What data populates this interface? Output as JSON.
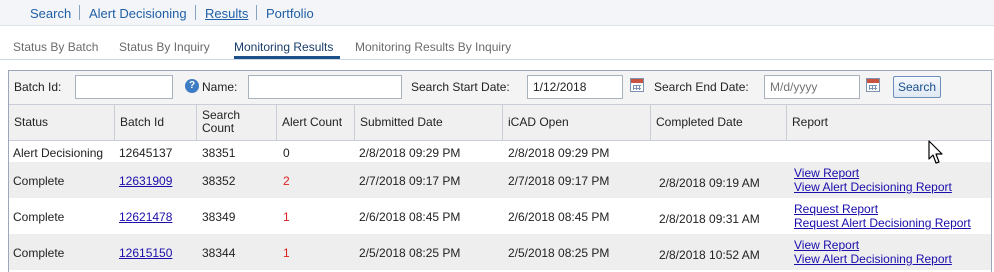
{
  "top_nav": {
    "items": [
      {
        "label": "Search"
      },
      {
        "label": "Alert Decisioning"
      },
      {
        "label": "Results",
        "active": true
      },
      {
        "label": "Portfolio"
      }
    ]
  },
  "sub_tabs": {
    "items": [
      {
        "label": "Status By Batch"
      },
      {
        "label": "Status By Inquiry"
      },
      {
        "label": "Monitoring Results",
        "active": true
      },
      {
        "label": "Monitoring Results By Inquiry"
      }
    ]
  },
  "filters": {
    "batch_id_label": "Batch Id:",
    "batch_id_value": "",
    "help_icon": "?",
    "name_label": "Name:",
    "name_value": "",
    "start_date_label": "Search Start Date:",
    "start_date_value": "1/12/2018",
    "end_date_label": "Search End Date:",
    "end_date_placeholder": "M/d/yyyy",
    "search_button": "Search"
  },
  "table": {
    "headers": {
      "status": "Status",
      "batch_id": "Batch Id",
      "search_count_line1": "Search",
      "search_count_line2": "Count",
      "alert_count": "Alert Count",
      "submitted_date": "Submitted Date",
      "icad_open": "iCAD Open",
      "completed_date": "Completed Date",
      "report": "Report"
    },
    "rows": [
      {
        "status": "Alert Decisioning",
        "batch_id": "12645137",
        "search_count": "38351",
        "alert_count": "0",
        "submitted": "2/8/2018 09:29 PM",
        "icad_open": "2/8/2018 09:29 PM",
        "completed": "",
        "report1": "",
        "report2": ""
      },
      {
        "status": "Complete",
        "batch_id": "12631909",
        "search_count": "38352",
        "alert_count": "2",
        "submitted": "2/7/2018 09:17 PM",
        "icad_open": "2/7/2018 09:17 PM",
        "completed": "2/8/2018 09:19 AM",
        "report1": "View Report",
        "report2": "View Alert Decisioning Report"
      },
      {
        "status": "Complete",
        "batch_id": "12621478",
        "search_count": "38349",
        "alert_count": "1",
        "submitted": "2/6/2018 08:45 PM",
        "icad_open": "2/6/2018 08:45 PM",
        "completed": "2/8/2018 09:31 AM",
        "report1": "Request Report",
        "report2": "Request Alert Decisioning Report"
      },
      {
        "status": "Complete",
        "batch_id": "12615150",
        "search_count": "38344",
        "alert_count": "1",
        "submitted": "2/5/2018 08:25 PM",
        "icad_open": "2/5/2018 08:25 PM",
        "completed": "2/8/2018 10:52 AM",
        "report1": "View Report",
        "report2": "View Alert Decisioning Report"
      }
    ]
  },
  "colors": {
    "link": "#1a0dab",
    "nav_link": "#1f5fa7",
    "alert_red": "#dd2222",
    "active_tab_underline": "#1b4f8a"
  }
}
